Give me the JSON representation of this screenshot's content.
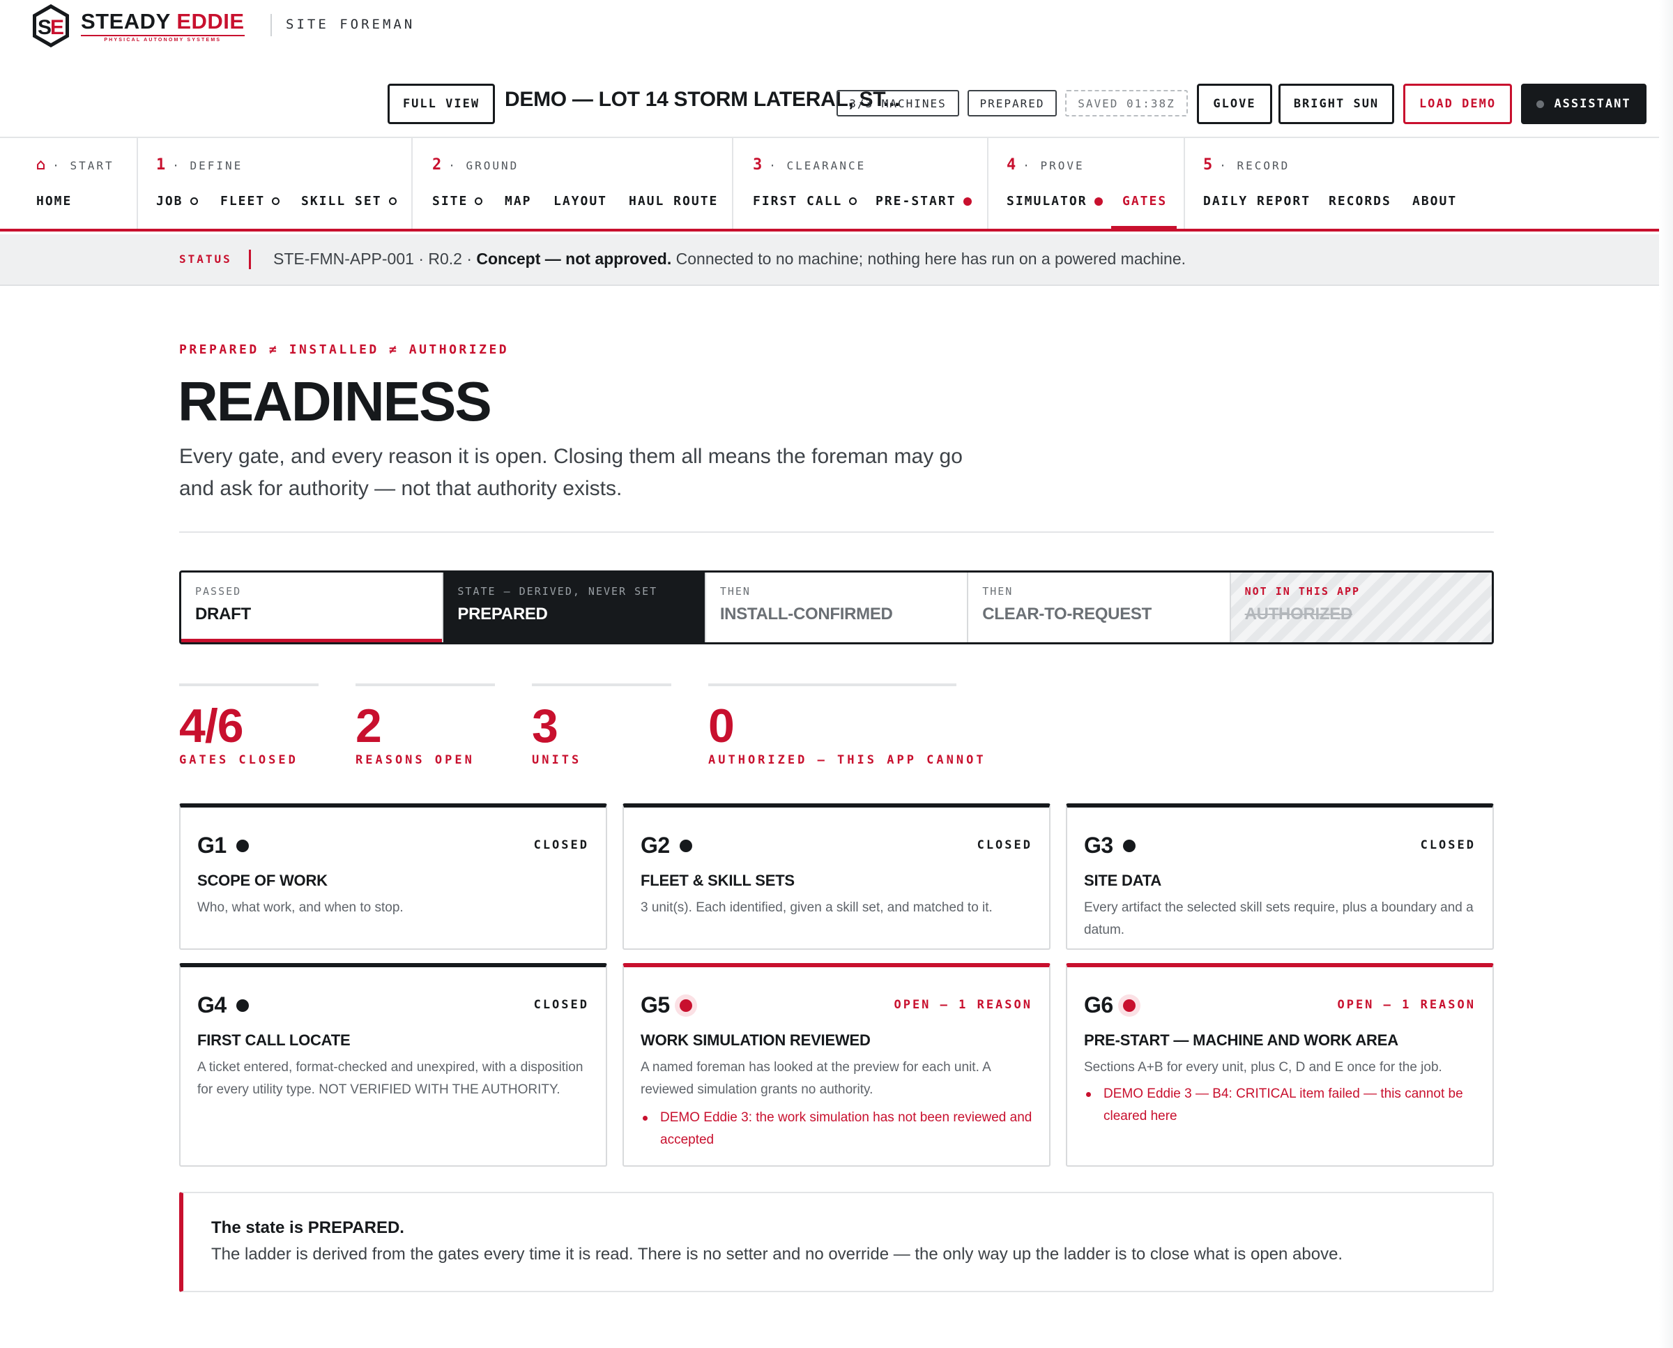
{
  "brand": {
    "name_part1": "STEADY",
    "name_part2": "EDDIE",
    "tagline": "PHYSICAL AUTONOMY SYSTEMS",
    "app_name": "SITE FOREMAN",
    "accent": "#c8102e"
  },
  "toolbar": {
    "full_view": "FULL VIEW",
    "job_title": "DEMO — LOT 14 STORM LATERAL, ST...",
    "machines": "3/3 MACHINES",
    "state": "PREPARED",
    "saved": "SAVED 01:38Z",
    "glove": "GLOVE",
    "bright_sun": "BRIGHT SUN",
    "load_demo": "LOAD DEMO",
    "assistant": "ASSISTANT"
  },
  "nav": {
    "groups": [
      {
        "num": "⌂",
        "label": "· START",
        "items": [
          "HOME"
        ]
      },
      {
        "num": "1",
        "label": "· DEFINE",
        "items": [
          "JOB",
          "FLEET",
          "SKILL SET"
        ]
      },
      {
        "num": "2",
        "label": "· GROUND",
        "items": [
          "SITE",
          "MAP",
          "LAYOUT",
          "HAUL ROUTE"
        ]
      },
      {
        "num": "3",
        "label": "· CLEARANCE",
        "items": [
          "FIRST CALL",
          "PRE-START"
        ]
      },
      {
        "num": "4",
        "label": "· PROVE",
        "items": [
          "SIMULATOR",
          "GATES"
        ]
      },
      {
        "num": "5",
        "label": "· RECORD",
        "items": [
          "DAILY REPORT",
          "RECORDS",
          "ABOUT"
        ]
      }
    ],
    "active": "GATES"
  },
  "status": {
    "label": "STATUS",
    "code": "STE-FMN-APP-001 · R0.2 · ",
    "bold": "Concept — not approved.",
    "rest": " Connected to no machine; nothing here has run on a powered machine."
  },
  "page": {
    "kicker": "PREPARED ≠ INSTALLED ≠ AUTHORIZED",
    "title": "READINESS",
    "lead": "Every gate, and every reason it is open. Closing them all means the foreman may go and ask for authority — not that authority exists."
  },
  "ladder": [
    {
      "key": "PASSED",
      "value": "DRAFT"
    },
    {
      "key": "STATE — DERIVED, NEVER SET",
      "value": "PREPARED"
    },
    {
      "key": "THEN",
      "value": "INSTALL-CONFIRMED"
    },
    {
      "key": "THEN",
      "value": "CLEAR-TO-REQUEST"
    },
    {
      "key": "NOT IN THIS APP",
      "value": "AUTHORIZED"
    }
  ],
  "stats": [
    {
      "value": "4/6",
      "label": "GATES CLOSED"
    },
    {
      "value": "2",
      "label": "REASONS OPEN"
    },
    {
      "value": "3",
      "label": "UNITS"
    },
    {
      "value": "0",
      "label": "AUTHORIZED — THIS APP CANNOT"
    }
  ],
  "gates": [
    {
      "id": "G1",
      "status": "CLOSED",
      "name": "SCOPE OF WORK",
      "desc": "Who, what work, and when to stop.",
      "reason": ""
    },
    {
      "id": "G2",
      "status": "CLOSED",
      "name": "FLEET & SKILL SETS",
      "desc": "3 unit(s). Each identified, given a skill set, and matched to it.",
      "reason": ""
    },
    {
      "id": "G3",
      "status": "CLOSED",
      "name": "SITE DATA",
      "desc": "Every artifact the selected skill sets require, plus a boundary and a datum.",
      "reason": ""
    },
    {
      "id": "G4",
      "status": "CLOSED",
      "name": "FIRST CALL LOCATE",
      "desc": "A ticket entered, format-checked and unexpired, with a disposition for every utility type. NOT VERIFIED WITH THE AUTHORITY.",
      "reason": ""
    },
    {
      "id": "G5",
      "status": "OPEN — 1 REASON",
      "name": "WORK SIMULATION REVIEWED",
      "desc": "A named foreman has looked at the preview for each unit. A reviewed simulation grants no authority.",
      "reason": "DEMO Eddie 3: the work simulation has not been reviewed and accepted"
    },
    {
      "id": "G6",
      "status": "OPEN — 1 REASON",
      "name": "PRE-START — MACHINE AND WORK AREA",
      "desc": "Sections A+B for every unit, plus C, D and E once for the job.",
      "reason": "DEMO Eddie 3 — B4: CRITICAL item failed — this cannot be cleared here"
    }
  ],
  "callout": {
    "title": "The state is PREPARED.",
    "body": "The ladder is derived from the gates every time it is read. There is no setter and no override — the only way up the ladder is to close what is open above."
  }
}
